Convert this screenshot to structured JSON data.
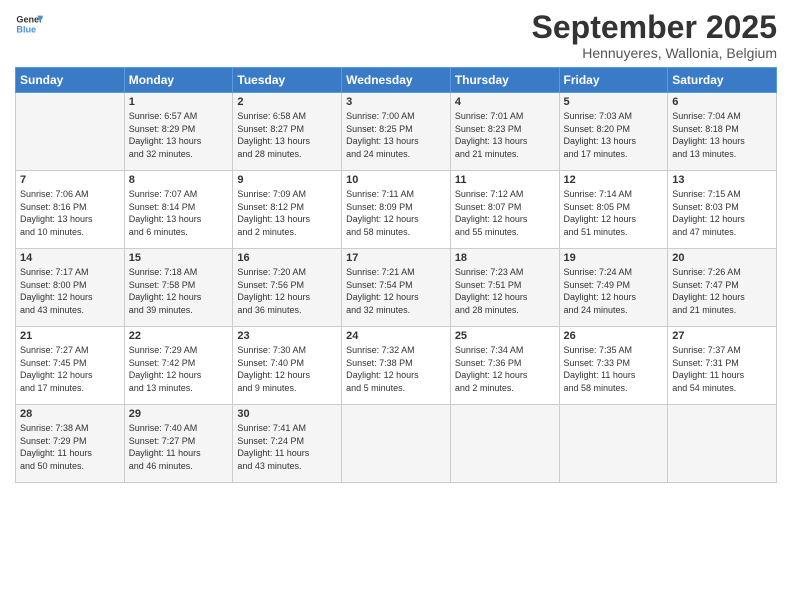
{
  "logo": {
    "line1": "General",
    "line2": "Blue"
  },
  "title": "September 2025",
  "subtitle": "Hennuyeres, Wallonia, Belgium",
  "days_of_week": [
    "Sunday",
    "Monday",
    "Tuesday",
    "Wednesday",
    "Thursday",
    "Friday",
    "Saturday"
  ],
  "weeks": [
    [
      {
        "num": "",
        "info": ""
      },
      {
        "num": "1",
        "info": "Sunrise: 6:57 AM\nSunset: 8:29 PM\nDaylight: 13 hours\nand 32 minutes."
      },
      {
        "num": "2",
        "info": "Sunrise: 6:58 AM\nSunset: 8:27 PM\nDaylight: 13 hours\nand 28 minutes."
      },
      {
        "num": "3",
        "info": "Sunrise: 7:00 AM\nSunset: 8:25 PM\nDaylight: 13 hours\nand 24 minutes."
      },
      {
        "num": "4",
        "info": "Sunrise: 7:01 AM\nSunset: 8:23 PM\nDaylight: 13 hours\nand 21 minutes."
      },
      {
        "num": "5",
        "info": "Sunrise: 7:03 AM\nSunset: 8:20 PM\nDaylight: 13 hours\nand 17 minutes."
      },
      {
        "num": "6",
        "info": "Sunrise: 7:04 AM\nSunset: 8:18 PM\nDaylight: 13 hours\nand 13 minutes."
      }
    ],
    [
      {
        "num": "7",
        "info": "Sunrise: 7:06 AM\nSunset: 8:16 PM\nDaylight: 13 hours\nand 10 minutes."
      },
      {
        "num": "8",
        "info": "Sunrise: 7:07 AM\nSunset: 8:14 PM\nDaylight: 13 hours\nand 6 minutes."
      },
      {
        "num": "9",
        "info": "Sunrise: 7:09 AM\nSunset: 8:12 PM\nDaylight: 13 hours\nand 2 minutes."
      },
      {
        "num": "10",
        "info": "Sunrise: 7:11 AM\nSunset: 8:09 PM\nDaylight: 12 hours\nand 58 minutes."
      },
      {
        "num": "11",
        "info": "Sunrise: 7:12 AM\nSunset: 8:07 PM\nDaylight: 12 hours\nand 55 minutes."
      },
      {
        "num": "12",
        "info": "Sunrise: 7:14 AM\nSunset: 8:05 PM\nDaylight: 12 hours\nand 51 minutes."
      },
      {
        "num": "13",
        "info": "Sunrise: 7:15 AM\nSunset: 8:03 PM\nDaylight: 12 hours\nand 47 minutes."
      }
    ],
    [
      {
        "num": "14",
        "info": "Sunrise: 7:17 AM\nSunset: 8:00 PM\nDaylight: 12 hours\nand 43 minutes."
      },
      {
        "num": "15",
        "info": "Sunrise: 7:18 AM\nSunset: 7:58 PM\nDaylight: 12 hours\nand 39 minutes."
      },
      {
        "num": "16",
        "info": "Sunrise: 7:20 AM\nSunset: 7:56 PM\nDaylight: 12 hours\nand 36 minutes."
      },
      {
        "num": "17",
        "info": "Sunrise: 7:21 AM\nSunset: 7:54 PM\nDaylight: 12 hours\nand 32 minutes."
      },
      {
        "num": "18",
        "info": "Sunrise: 7:23 AM\nSunset: 7:51 PM\nDaylight: 12 hours\nand 28 minutes."
      },
      {
        "num": "19",
        "info": "Sunrise: 7:24 AM\nSunset: 7:49 PM\nDaylight: 12 hours\nand 24 minutes."
      },
      {
        "num": "20",
        "info": "Sunrise: 7:26 AM\nSunset: 7:47 PM\nDaylight: 12 hours\nand 21 minutes."
      }
    ],
    [
      {
        "num": "21",
        "info": "Sunrise: 7:27 AM\nSunset: 7:45 PM\nDaylight: 12 hours\nand 17 minutes."
      },
      {
        "num": "22",
        "info": "Sunrise: 7:29 AM\nSunset: 7:42 PM\nDaylight: 12 hours\nand 13 minutes."
      },
      {
        "num": "23",
        "info": "Sunrise: 7:30 AM\nSunset: 7:40 PM\nDaylight: 12 hours\nand 9 minutes."
      },
      {
        "num": "24",
        "info": "Sunrise: 7:32 AM\nSunset: 7:38 PM\nDaylight: 12 hours\nand 5 minutes."
      },
      {
        "num": "25",
        "info": "Sunrise: 7:34 AM\nSunset: 7:36 PM\nDaylight: 12 hours\nand 2 minutes."
      },
      {
        "num": "26",
        "info": "Sunrise: 7:35 AM\nSunset: 7:33 PM\nDaylight: 11 hours\nand 58 minutes."
      },
      {
        "num": "27",
        "info": "Sunrise: 7:37 AM\nSunset: 7:31 PM\nDaylight: 11 hours\nand 54 minutes."
      }
    ],
    [
      {
        "num": "28",
        "info": "Sunrise: 7:38 AM\nSunset: 7:29 PM\nDaylight: 11 hours\nand 50 minutes."
      },
      {
        "num": "29",
        "info": "Sunrise: 7:40 AM\nSunset: 7:27 PM\nDaylight: 11 hours\nand 46 minutes."
      },
      {
        "num": "30",
        "info": "Sunrise: 7:41 AM\nSunset: 7:24 PM\nDaylight: 11 hours\nand 43 minutes."
      },
      {
        "num": "",
        "info": ""
      },
      {
        "num": "",
        "info": ""
      },
      {
        "num": "",
        "info": ""
      },
      {
        "num": "",
        "info": ""
      }
    ]
  ]
}
